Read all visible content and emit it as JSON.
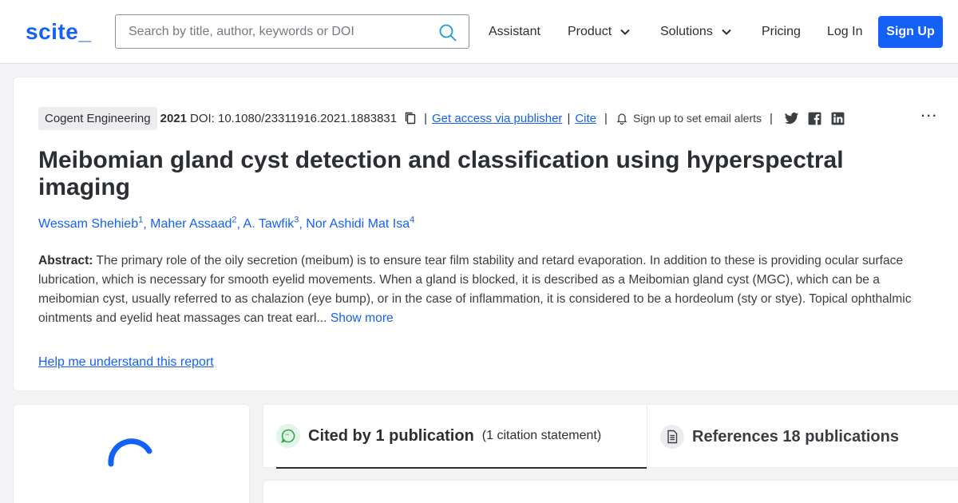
{
  "header": {
    "logo": "scite_",
    "search_placeholder": "Search by title, author, keywords or DOI",
    "nav": {
      "assistant": "Assistant",
      "product": "Product",
      "solutions": "Solutions",
      "pricing": "Pricing",
      "login": "Log In",
      "signup": "Sign Up"
    }
  },
  "paper": {
    "journal": "Cogent Engineering",
    "year": "2021",
    "doi": "DOI: 10.1080/23311916.2021.1883831",
    "access_link": "Get access via publisher",
    "cite_link": "Cite",
    "alert_text": "Sign up to set email alerts",
    "more_menu": "...",
    "title": "Meibomian gland cyst detection and classification using hyperspectral imaging",
    "authors": [
      {
        "name": "Wessam Shehieb",
        "sup": "1"
      },
      {
        "name": "Maher Assaad",
        "sup": "2"
      },
      {
        "name": "A. Tawfik",
        "sup": "3"
      },
      {
        "name": "Nor Ashidi Mat Isa",
        "sup": "4"
      }
    ],
    "abstract_label": "Abstract:",
    "abstract_text": "The primary role of the oily secretion (meibum) is to ensure tear film stability and retard evaporation. In addition to these is providing ocular surface lubrication, which is necessary for smooth eyelid movements. When a gland is blocked, it is described as a Meibomian gland cyst (MGC), which can be a meibomian cyst, usually referred to as chalazion (eye bump), or in the case of inflammation, it is considered to be a hordeolum (sty or stye). Topical ophthalmic ointments and eyelid heat massages can treat earl...",
    "show_more": "Show more",
    "help_link": "Help me understand this report"
  },
  "tabs": {
    "cited_strong": "Cited by 1 publication",
    "cited_sub": "(1 citation statement)",
    "refs_strong": "References 18 publications"
  },
  "colors": {
    "brand": "#1361f6",
    "cited_icon_bg": "#e3f5e8",
    "cited_icon": "#2da84f"
  }
}
